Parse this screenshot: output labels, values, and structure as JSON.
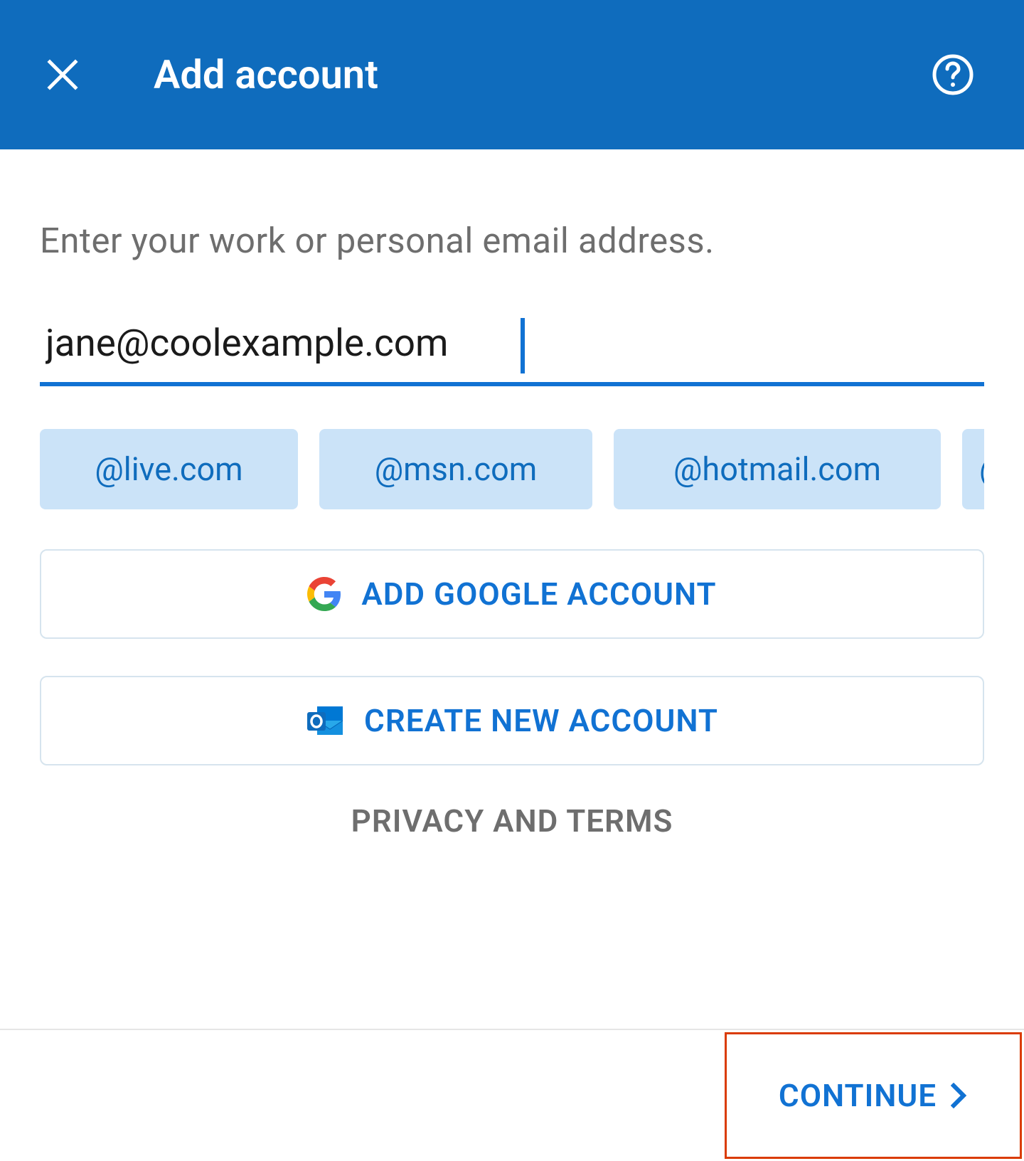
{
  "header": {
    "title": "Add account"
  },
  "content": {
    "prompt": "Enter your work or personal email address.",
    "email_value": "jane@coolexample.com",
    "domain_suggestions": [
      "@live.com",
      "@msn.com",
      "@hotmail.com",
      "@"
    ],
    "google_button_label": "ADD GOOGLE ACCOUNT",
    "create_button_label": "CREATE NEW ACCOUNT",
    "privacy_label": "PRIVACY AND TERMS"
  },
  "footer": {
    "continue_label": "CONTINUE"
  }
}
